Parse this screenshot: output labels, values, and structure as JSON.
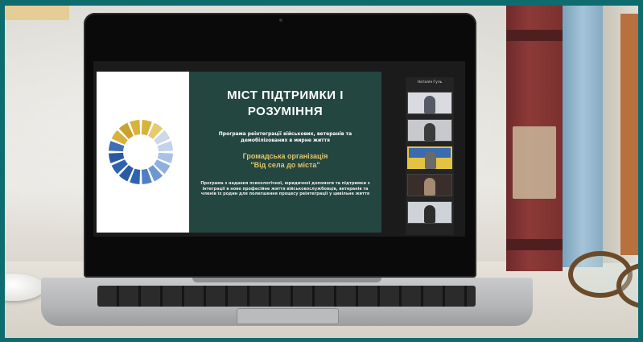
{
  "slide": {
    "title_line1": "МІСТ ПІДТРИМКИ І",
    "title_line2": "РОЗУМІННЯ",
    "subtitle": "Програма реінтеграції військових, ветеранів та демобілізованих в мирне життя",
    "org_line1": "Громадська організація",
    "org_line2": "\"Від села до міста\"",
    "body": "Програма з надання психологічної, юридичної допомоги та підтримки з інтеграції в нове професійне життя військовослужбовців, ветеранів та членів їх родин для полегшення процесу реінтеграції у цивільне життя"
  },
  "participants_panel": {
    "header": "Наталія Гуль",
    "participants": [
      "",
      "",
      "",
      "",
      ""
    ]
  },
  "colors": {
    "frame_border": "#0e6b6e",
    "slide_background": "#234640",
    "accent_yellow": "#e3c66a",
    "ring_blue": "#2f63ae",
    "ring_gold": "#d8b23a"
  }
}
